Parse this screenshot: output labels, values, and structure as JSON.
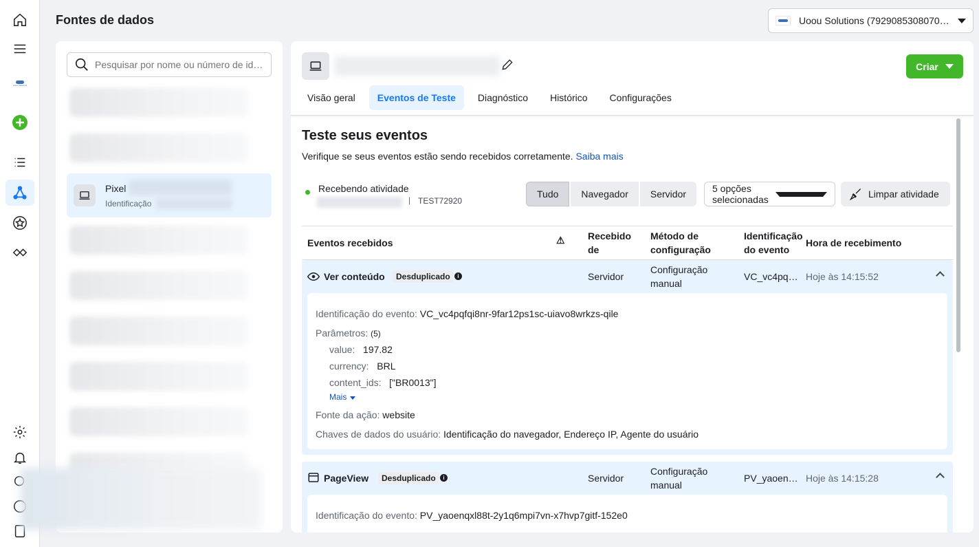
{
  "page": {
    "title": "Fontes de dados"
  },
  "account": {
    "label": "Uoou Solutions (7929085308070…"
  },
  "rail": {
    "items": [
      "home-icon",
      "menu-icon",
      "brand-logo",
      "create-icon",
      "list-icon",
      "data-sources-icon",
      "star-icon",
      "partner-icon",
      "settings-icon",
      "notifications-icon",
      "search-icon",
      "help-icon",
      "reports-icon"
    ],
    "brand_text": "Uoou Solutions"
  },
  "sources": {
    "search_placeholder": "Pesquisar por nome ou número de id…",
    "selected": {
      "name": "Pixel",
      "sub": "Identificação"
    }
  },
  "detail": {
    "create_label": "Criar",
    "tabs": [
      "Visão geral",
      "Eventos de Teste",
      "Diagnóstico",
      "Histórico",
      "Configurações"
    ],
    "heading": "Teste seus eventos",
    "description": "Verifique se seus eventos estão sendo recebidos corretamente.",
    "learn_more": "Saiba mais",
    "status": "Recebendo atividade",
    "separator": "|",
    "test_code": "TEST72920",
    "filters": [
      "Tudo",
      "Navegador",
      "Servidor"
    ],
    "options": "5 opções selecionadas",
    "clear": "Limpar atividade",
    "table": {
      "headers": {
        "events": "Eventos recebidos",
        "warn": "⚠",
        "received_from": "Recebido de",
        "method": "Método de configuração",
        "event_id": "Identificação do evento",
        "time": "Hora de recebimento"
      },
      "events": [
        {
          "name": "Ver conteúdo",
          "badge": "Desduplicado",
          "source": "Servidor",
          "method": "Configuração manual",
          "event_id_short": "VC_vc4pq…",
          "time": "Hoje às 14:15:52",
          "detail": {
            "id_label": "Identificação do evento:",
            "id_value": "VC_vc4pqfqi8nr-9far12ps1sc-uiavo8wrkzs-qile",
            "params_label": "Parâmetros:",
            "params_count": "(5)",
            "params": [
              {
                "k": "value:",
                "v": "197.82"
              },
              {
                "k": "currency:",
                "v": "BRL"
              },
              {
                "k": "content_ids:",
                "v": "[\"BR0013\"]"
              }
            ],
            "more": "Mais",
            "action_source_label": "Fonte da ação:",
            "action_source_value": "website",
            "user_keys_label": "Chaves de dados do usuário:",
            "user_keys_value": "Identificação do navegador, Endereço IP, Agente do usuário"
          }
        },
        {
          "name": "PageView",
          "badge": "Desduplicado",
          "source": "Servidor",
          "method": "Configuração manual",
          "event_id_short": "PV_yaoen…",
          "time": "Hoje às 14:15:28",
          "detail": {
            "id_label": "Identificação do evento:",
            "id_value": "PV_yaoenqxl88t-2y1q6mpi7vn-x7hvp7gitf-152e0"
          }
        }
      ]
    }
  }
}
